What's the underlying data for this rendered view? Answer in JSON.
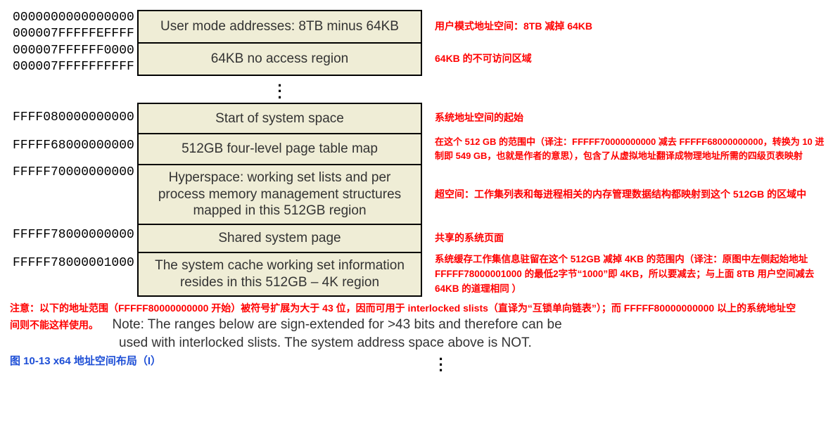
{
  "group1": [
    {
      "addr": [
        "0000000000000000",
        "000007FFFFFEFFFF"
      ],
      "box": "User mode addresses: 8TB minus 64KB",
      "note": "用户模式地址空间：8TB 减掉 64KB"
    },
    {
      "addr": [
        "000007FFFFFF0000",
        "000007FFFFFFFFFF"
      ],
      "box": "64KB no access region",
      "note": "64KB 的不可访问区域"
    }
  ],
  "group2": [
    {
      "addr": [
        "FFFF080000000000"
      ],
      "box": "Start of system space",
      "note": "系统地址空间的起始"
    },
    {
      "addr": [
        "FFFFF68000000000"
      ],
      "box": "512GB four-level page table map",
      "note": "在这个 512 GB 的范围中（译注：FFFFF70000000000 减去 FFFFF68000000000，转换为 10 进制即 549 GB，也就是作者的意思），包含了从虚拟地址翻译成物理地址所需的四级页表映射"
    },
    {
      "addr": [
        "FFFFF70000000000"
      ],
      "box": "Hyperspace: working set lists and per process memory management structures mapped in this 512GB region",
      "note": "超空间：工作集列表和每进程相关的内存管理数据结构都映射到这个 512GB 的区域中"
    },
    {
      "addr": [
        "FFFFF78000000000"
      ],
      "box": "Shared system page",
      "note": "共享的系统页面"
    },
    {
      "addr": [
        "FFFFF78000001000"
      ],
      "box": "The system cache working set information resides in this 512GB – 4K region",
      "note": "系统缓存工作集信息驻留在这个 512GB 减掉 4KB 的范围内（译注：原图中左侧起始地址 FFFFF78000001000 的最低2字节“1000”即 4KB，所以要减去；与上面 8TB 用户空间减去 64KB 的道理相同 ）"
    }
  ],
  "footer": {
    "red1": "注意：以下的地址范围（FFFFF80000000000 开始）被符号扩展为大于 43 位，因而可用于 interlocked slists（直译为“互锁单向链表”）；而 FFFFF80000000000 以上的系统地址空",
    "red2": "间则不能这样使用。",
    "black1": "Note: The ranges below are sign-extended for >43 bits and therefore can be",
    "black2": "used with interlocked slists. The system address space above is NOT."
  },
  "caption": "图 10-13 x64 地址空间布局（I）",
  "dots": "."
}
